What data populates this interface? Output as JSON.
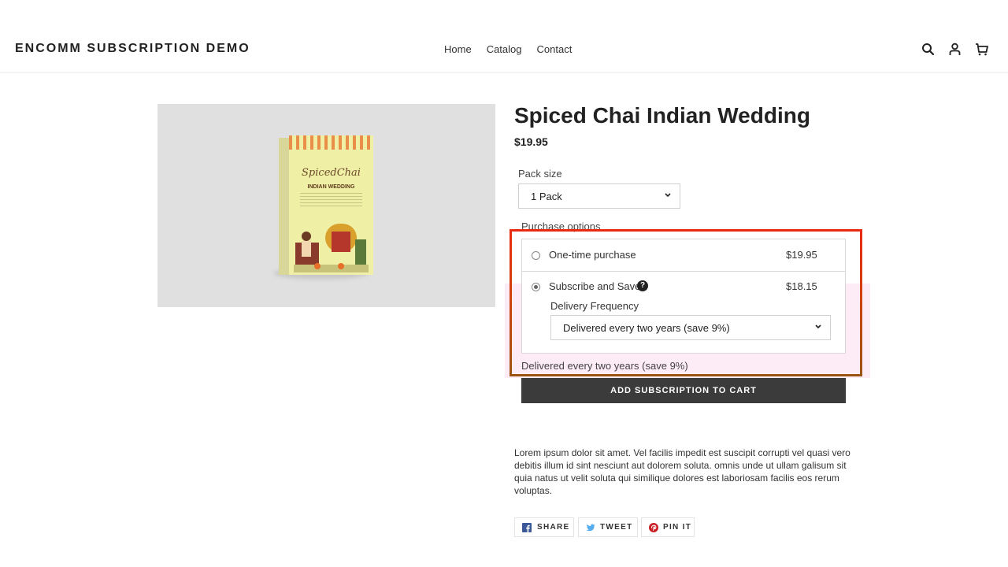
{
  "header": {
    "brand": "ENCOMM SUBSCRIPTION DEMO",
    "nav": [
      "Home",
      "Catalog",
      "Contact"
    ],
    "icons": [
      "search-icon",
      "account-icon",
      "cart-icon"
    ]
  },
  "product": {
    "title": "Spiced Chai Indian Wedding",
    "price": "$19.95",
    "image": {
      "logo_text": "SpicedChai",
      "subtitle": "INDIAN WEDDING"
    }
  },
  "pack_size": {
    "label": "Pack size",
    "value": "1 Pack"
  },
  "purchase_options": {
    "label": "Purchase options",
    "one_time": {
      "label": "One-time purchase",
      "price": "$19.95",
      "selected": false
    },
    "subscribe": {
      "label": "Subscribe and Save",
      "price": "$18.15",
      "selected": true,
      "help_icon": "?"
    },
    "delivery_frequency": {
      "label": "Delivery Frequency",
      "value": "Delivered every two years (save 9%)"
    },
    "selected_summary": "Delivered every two years (save 9%)"
  },
  "cart": {
    "button_label": "ADD SUBSCRIPTION TO CART"
  },
  "description": "Lorem ipsum dolor sit amet. Vel facilis impedit est suscipit corrupti vel quasi vero debitis illum id sint nesciunt aut dolorem soluta.  omnis unde ut ullam galisum sit quia natus ut velit soluta qui similique dolores est laboriosam facilis eos rerum voluptas.",
  "share": {
    "facebook": "SHARE",
    "twitter": "TWEET",
    "pinterest": "PIN IT"
  },
  "colors": {
    "highlight_outline": "#e92a12",
    "highlight_fill": "#fdebf5",
    "button_bg": "#3b3b3b",
    "facebook": "#3b5998",
    "twitter": "#55acee",
    "pinterest": "#cb2027"
  }
}
